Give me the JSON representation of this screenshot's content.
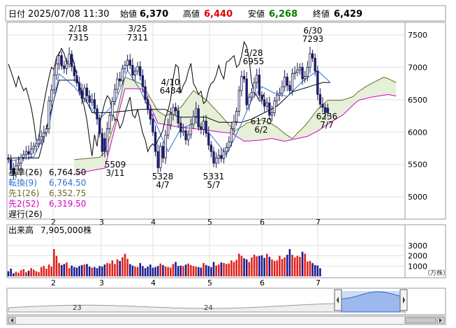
{
  "header": {
    "date_label": "日付",
    "date_value": "2025/07/08 11:30",
    "open_label": "始値",
    "open_value": "6,370",
    "high_label": "高値",
    "high_value": "6,440",
    "low_label": "安値",
    "low_value": "6,268",
    "close_label": "終値",
    "close_value": "6,429"
  },
  "colors": {
    "up": "#ffffff",
    "down": "#1a1a8c",
    "kijun": "#000000",
    "tenkan": "#2a6fd6",
    "senkou_a": "#6b6b2a",
    "senkou_b": "#d600c8",
    "chikou": "#000000",
    "cloud": "#e6f0d8",
    "vol_up": "#e0201a",
    "vol_down": "#1a1a8c",
    "high_value": "#e00000",
    "low_value": "#008000"
  },
  "legend": [
    {
      "label": "基準(26)",
      "value": "6,764.50",
      "color": "#000000"
    },
    {
      "label": "転換(9)",
      "value": "6,764.50",
      "color": "#2a6fd6"
    },
    {
      "label": "先1(26)",
      "value": "6,352.75",
      "color": "#6b6b2a"
    },
    {
      "label": "先2(52)",
      "value": "6,319.50",
      "color": "#d600c8"
    },
    {
      "label": "遅行(26)",
      "value": "",
      "color": "#000000"
    }
  ],
  "volume_label": "出来高",
  "volume_value": "7,905,000株",
  "volume_unit": "（万株）",
  "chart_data": {
    "type": "candlestick",
    "price_axis_ticks": [
      "7500",
      "7000",
      "6500",
      "6000",
      "5500",
      "5000"
    ],
    "price_ylim": [
      4700,
      7650
    ],
    "volume_axis_ticks": [
      "3000",
      "2000",
      "1000"
    ],
    "volume_ylim": [
      0,
      3800
    ],
    "month_ticks": [
      "2",
      "3",
      "4",
      "5",
      "6",
      "7"
    ],
    "overview_ticks": [
      "23",
      "24"
    ],
    "annotations": [
      {
        "date": "2/18",
        "value": "7315"
      },
      {
        "date": "3/25",
        "value": "7311"
      },
      {
        "date": "4/10",
        "value": "6484"
      },
      {
        "date": "3/11",
        "value": "5509"
      },
      {
        "date": "4/7",
        "value": "5328"
      },
      {
        "date": "5/7",
        "value": "5331"
      },
      {
        "date": "5/28",
        "value": "6955"
      },
      {
        "date": "6/2",
        "value": "6170"
      },
      {
        "date": "6/30",
        "value": "7293"
      },
      {
        "date": "7/7",
        "value": "6236"
      }
    ],
    "closes": [
      5580,
      5440,
      5350,
      5480,
      5520,
      5610,
      5650,
      5700,
      5660,
      5740,
      5780,
      5820,
      5880,
      5930,
      5990,
      6050,
      6480,
      6650,
      6880,
      7050,
      7180,
      7020,
      6980,
      7050,
      7200,
      7010,
      6870,
      6760,
      6640,
      6520,
      6680,
      6560,
      6460,
      6500,
      6360,
      6200,
      5980,
      5700,
      5700,
      6050,
      6260,
      6470,
      6660,
      6820,
      6790,
      6980,
      7030,
      7110,
      7030,
      6880,
      6940,
      7010,
      6870,
      6700,
      6500,
      6350,
      6200,
      6000,
      5700,
      5450,
      5780,
      5600,
      5950,
      6110,
      6270,
      6380,
      6330,
      6140,
      6000,
      6020,
      5880,
      5960,
      6120,
      6240,
      6360,
      6080,
      6040,
      6170,
      5980,
      5800,
      5700,
      5520,
      5600,
      5640,
      5590,
      5700,
      5760,
      5850,
      6050,
      6160,
      6320,
      6640,
      6860,
      6820,
      6420,
      6540,
      6610,
      6760,
      6880,
      6570,
      6500,
      6400,
      6450,
      6260,
      6300,
      6480,
      6570,
      6600,
      6700,
      6850,
      6720,
      6640,
      6900,
      6920,
      6960,
      7000,
      6820,
      6860,
      7000,
      7210,
      7140,
      6940,
      6580,
      6430,
      6380,
      6300,
      6300,
      6429
    ],
    "opens": [
      5600,
      5580,
      5440,
      5350,
      5480,
      5520,
      5610,
      5650,
      5700,
      5660,
      5740,
      5780,
      5820,
      5880,
      5930,
      5990,
      6050,
      6480,
      6650,
      6880,
      7050,
      7180,
      7020,
      6980,
      7050,
      7200,
      7010,
      6870,
      6760,
      6640,
      6520,
      6680,
      6560,
      6460,
      6500,
      6360,
      6200,
      5980,
      5900,
      5700,
      6050,
      6260,
      6470,
      6660,
      6820,
      6790,
      6980,
      7030,
      7110,
      7030,
      6880,
      6940,
      7010,
      6870,
      6700,
      6500,
      6350,
      6200,
      6000,
      5700,
      5450,
      5780,
      5600,
      5950,
      6110,
      6270,
      6380,
      6330,
      6140,
      6000,
      6020,
      5880,
      5960,
      6120,
      6240,
      6360,
      6080,
      6040,
      6170,
      5980,
      5800,
      5700,
      5520,
      5600,
      5640,
      5590,
      5700,
      5760,
      5850,
      6050,
      6160,
      6320,
      6640,
      6860,
      6820,
      6420,
      6540,
      6610,
      6760,
      6880,
      6570,
      6500,
      6400,
      6450,
      6260,
      6300,
      6480,
      6570,
      6600,
      6700,
      6850,
      6720,
      6640,
      6900,
      6920,
      6960,
      7000,
      6820,
      6860,
      7000,
      7210,
      7140,
      6940,
      6580,
      6430,
      6380,
      6370
    ],
    "volumes": [
      500,
      750,
      300,
      450,
      350,
      600,
      700,
      400,
      550,
      800,
      650,
      500,
      400,
      900,
      1000,
      750,
      1150,
      950,
      2650,
      2000,
      1300,
      1100,
      1200,
      1350,
      800,
      1050,
      900,
      850,
      1000,
      1100,
      1150,
      1200,
      950,
      850,
      900,
      800,
      1000,
      950,
      1150,
      1300,
      1250,
      1550,
      1200,
      1650,
      1500,
      1850,
      2200,
      1700,
      1200,
      1050,
      950,
      900,
      1300,
      1000,
      800,
      950,
      1150,
      850,
      900,
      1000,
      1250,
      1100,
      950,
      900,
      850,
      1200,
      1400,
      1000,
      1050,
      1000,
      1150,
      1250,
      1100,
      1000,
      950,
      900,
      850,
      1300,
      1100,
      1000,
      900,
      1400,
      1050,
      1150,
      1350,
      1300,
      1200,
      1250,
      1550,
      1400,
      1600,
      2200,
      2000,
      1750,
      1650,
      1400,
      1850,
      2100,
      1950,
      2000,
      2050,
      1800,
      2200,
      1900,
      1650,
      1500,
      1550,
      2000,
      1700,
      1850,
      2100,
      2650,
      2100,
      1850,
      2000,
      1900,
      2400,
      2200,
      1450,
      1500,
      1300,
      1100,
      1050,
      790
    ],
    "kijun_by_index": [
      [
        0,
        5600
      ],
      [
        12,
        5600
      ],
      [
        14,
        5900
      ],
      [
        20,
        6800
      ],
      [
        27,
        6800
      ],
      [
        33,
        6300
      ],
      [
        40,
        6300
      ],
      [
        52,
        6350
      ],
      [
        62,
        6350
      ],
      [
        67,
        6230
      ],
      [
        78,
        6230
      ],
      [
        83,
        6150
      ],
      [
        92,
        6150
      ],
      [
        96,
        6200
      ],
      [
        106,
        6400
      ],
      [
        112,
        6620
      ],
      [
        124,
        6764.5
      ],
      [
        127,
        6764.5
      ]
    ],
    "tenkan_by_index": [
      [
        0,
        5550
      ],
      [
        10,
        5620
      ],
      [
        16,
        6100
      ],
      [
        20,
        6900
      ],
      [
        26,
        6700
      ],
      [
        31,
        6450
      ],
      [
        36,
        6200
      ],
      [
        42,
        6450
      ],
      [
        47,
        6950
      ],
      [
        52,
        6650
      ],
      [
        58,
        6150
      ],
      [
        63,
        5700
      ],
      [
        68,
        6050
      ],
      [
        74,
        6150
      ],
      [
        80,
        5950
      ],
      [
        86,
        5650
      ],
      [
        91,
        6050
      ],
      [
        96,
        6500
      ],
      [
        100,
        6700
      ],
      [
        105,
        6600
      ],
      [
        110,
        6550
      ],
      [
        116,
        6780
      ],
      [
        122,
        6950
      ],
      [
        127,
        6764.5
      ]
    ]
  }
}
